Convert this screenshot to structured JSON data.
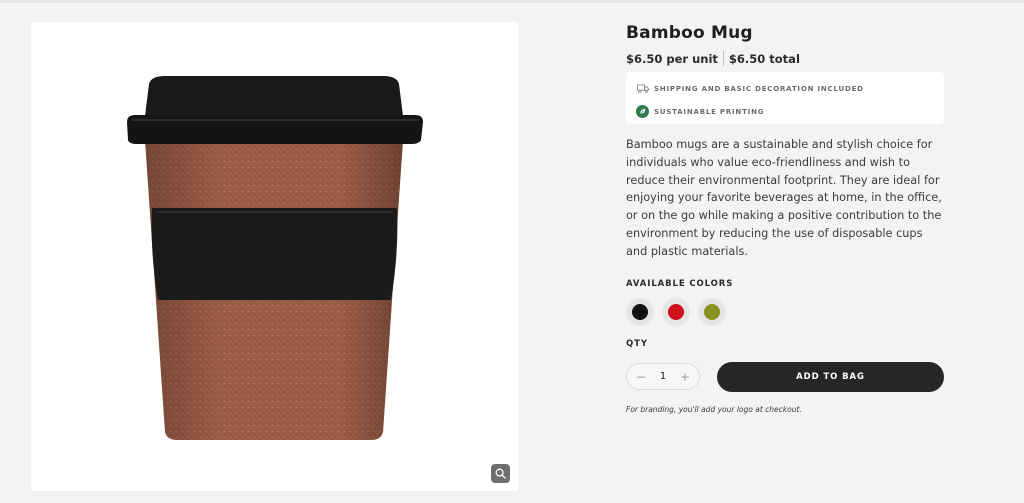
{
  "product": {
    "title": "Bamboo Mug",
    "price_unit": "$6.50 per unit",
    "price_total": "$6.50 total",
    "image_icon": "bamboo-mug-image",
    "zoom_icon": "magnifier-icon"
  },
  "features": [
    {
      "icon": "truck-icon",
      "text": "SHIPPING AND BASIC DECORATION INCLUDED"
    },
    {
      "icon": "leaf-icon",
      "text": "SUSTAINABLE PRINTING",
      "icon_color": "#2e7d4f"
    }
  ],
  "description": "Bamboo mugs are a sustainable and stylish choice for individuals who value eco-friendliness and wish to reduce their environmental footprint. They are ideal for enjoying your favorite beverages at home, in the office, or on the go while making a positive contribution to the environment by reducing the use of disposable cups and plastic materials.",
  "colors": {
    "label": "AVAILABLE COLORS",
    "options": [
      {
        "name": "black",
        "hex": "#111111"
      },
      {
        "name": "red",
        "hex": "#d0141e"
      },
      {
        "name": "olive",
        "hex": "#8a9222"
      }
    ]
  },
  "quantity": {
    "label": "QTY",
    "value": "1",
    "minus": "−",
    "plus": "+"
  },
  "add_to_bag_label": "ADD TO BAG",
  "branding_note": "For branding, you'll add your logo at checkout."
}
